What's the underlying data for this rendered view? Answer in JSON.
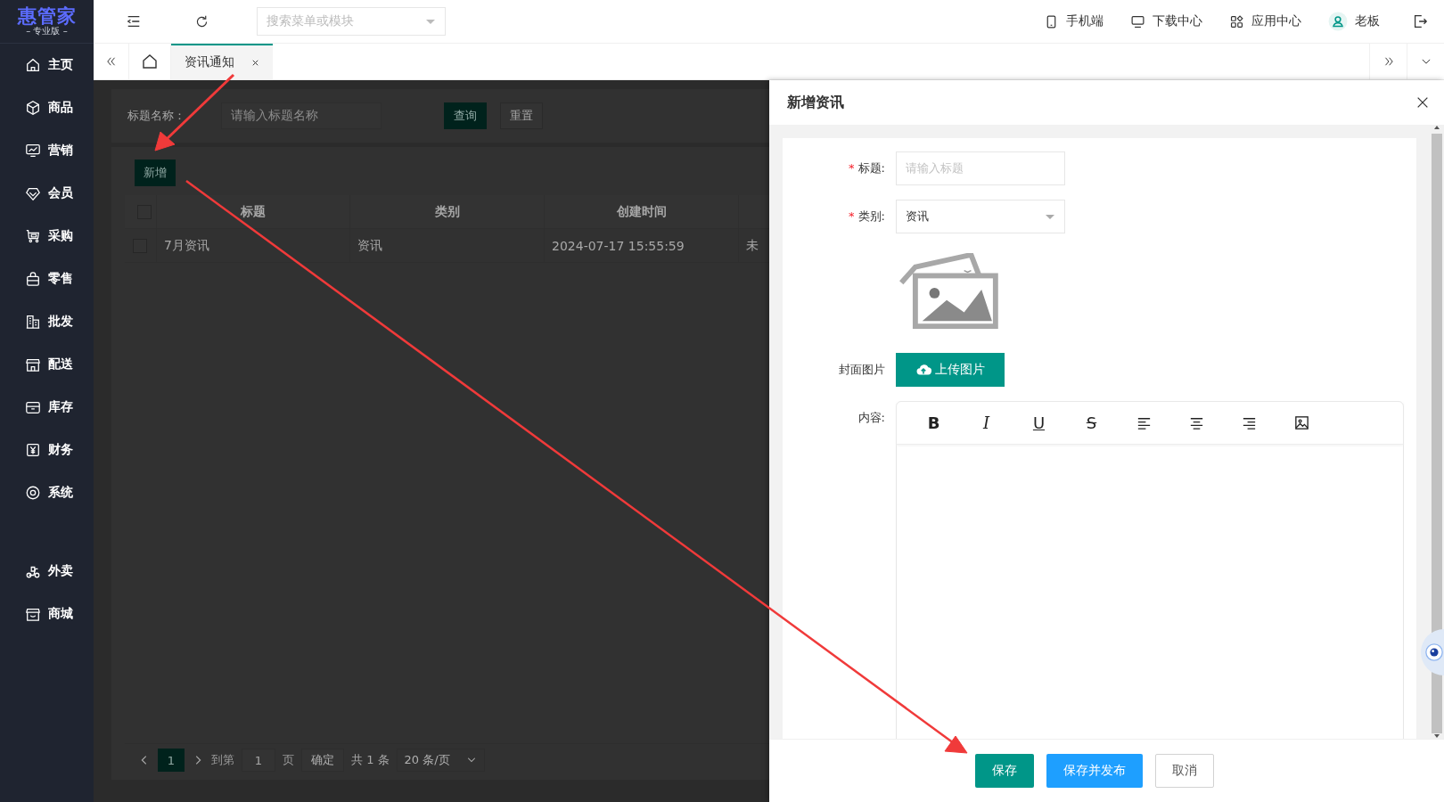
{
  "sidebar": {
    "logo": {
      "name": "惠管家",
      "edition": "– 专业版 –"
    },
    "items": [
      {
        "label": "主页",
        "selected": false
      },
      {
        "label": "商品",
        "selected": false
      },
      {
        "label": "营销",
        "selected": false
      },
      {
        "label": "会员",
        "selected": false
      },
      {
        "label": "采购",
        "selected": false
      },
      {
        "label": "零售",
        "selected": false
      },
      {
        "label": "批发",
        "selected": false
      },
      {
        "label": "配送",
        "selected": false
      },
      {
        "label": "库存",
        "selected": false
      },
      {
        "label": "财务",
        "selected": false
      },
      {
        "label": "系统",
        "selected": false
      }
    ],
    "extra_items": [
      {
        "label": "外卖",
        "selected": false
      },
      {
        "label": "商城",
        "selected": false
      }
    ]
  },
  "topbar": {
    "search": {
      "placeholder": "搜索菜单或模块"
    },
    "links": [
      {
        "label": "手机端"
      },
      {
        "label": "下载中心"
      },
      {
        "label": "应用中心"
      },
      {
        "label": "老板"
      }
    ]
  },
  "tabs": [
    {
      "label": "资讯通知",
      "selected": true
    }
  ],
  "page": {
    "filter": {
      "label": "标题名称：",
      "placeholder": "请输入标题名称",
      "buttons": [
        "查询",
        "重置"
      ]
    },
    "add_button": "新增",
    "table": {
      "columns": [
        "标题",
        "类别",
        "创建时间"
      ],
      "all_checked": false,
      "rows": [
        {
          "checked": false,
          "cells": [
            "7月资讯",
            "资讯",
            "2024-07-17 15:55:59",
            "未"
          ]
        }
      ]
    },
    "pagination": {
      "pages": [
        {
          "label": "1",
          "selected": true
        }
      ],
      "goto_label": "到第",
      "goto_value": "1",
      "page_unit": "页",
      "confirm": "确定",
      "total": "共 1 条",
      "page_size": "20 条/页"
    }
  },
  "drawer": {
    "title": "新增资讯",
    "fields": [
      {
        "kind": "input",
        "label": "标题:",
        "required_mark": "*",
        "placeholder": "请输入标题"
      },
      {
        "kind": "select",
        "label": "类别:",
        "required_mark": "*",
        "value": "资讯"
      },
      {
        "kind": "upload",
        "label": "封面图片",
        "button": "上传图片"
      },
      {
        "kind": "editor",
        "label": "内容:"
      }
    ],
    "editor_tools": [
      {
        "kind": "bold",
        "label": "B"
      },
      {
        "kind": "italic",
        "label": "I"
      },
      {
        "kind": "underline",
        "label": "U"
      },
      {
        "kind": "strike",
        "label": "S"
      },
      {
        "kind": "align-left"
      },
      {
        "kind": "align-center"
      },
      {
        "kind": "align-right"
      },
      {
        "kind": "image"
      }
    ],
    "buttons": [
      {
        "label": "保存",
        "kind": "primary"
      },
      {
        "label": "保存并发布",
        "kind": "info"
      },
      {
        "label": "取消",
        "kind": "default"
      }
    ]
  }
}
